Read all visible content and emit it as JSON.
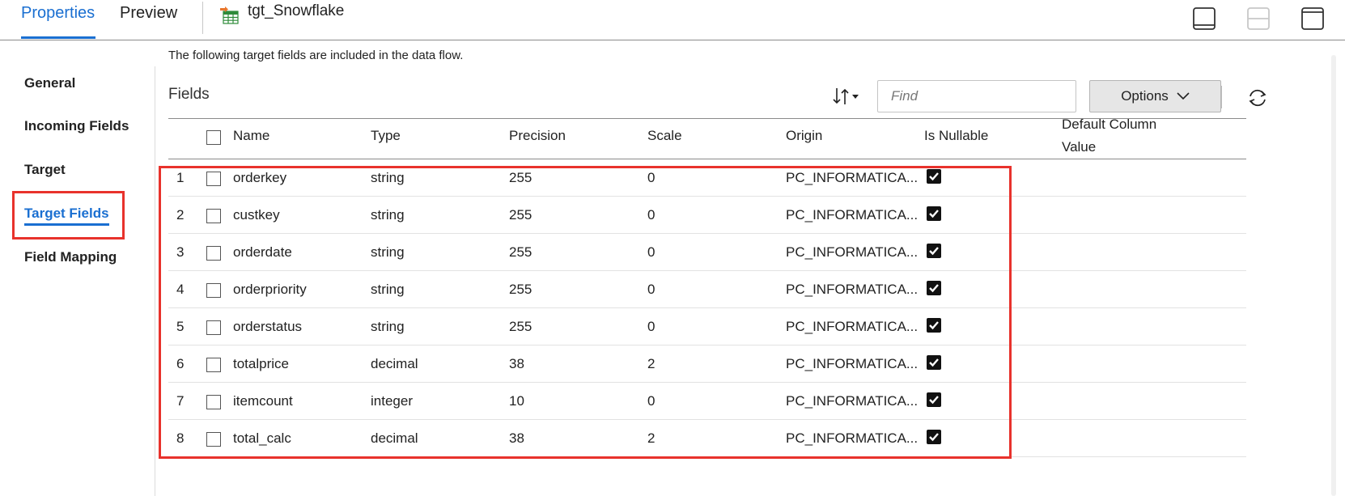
{
  "tabs": {
    "properties": "Properties",
    "preview": "Preview",
    "target_name": "tgt_Snowflake"
  },
  "nav": {
    "items": [
      {
        "label": "General",
        "active": false
      },
      {
        "label": "Incoming Fields",
        "active": false
      },
      {
        "label": "Target",
        "active": false
      },
      {
        "label": "Target Fields",
        "active": true
      },
      {
        "label": "Field Mapping",
        "active": false
      }
    ]
  },
  "main": {
    "description": "The following target fields are included in the data flow.",
    "section_title": "Fields",
    "find_placeholder": "Find",
    "find_value": "",
    "options_label": "Options"
  },
  "table": {
    "headers": {
      "name": "Name",
      "type": "Type",
      "precision": "Precision",
      "scale": "Scale",
      "origin": "Origin",
      "nullable": "Is Nullable",
      "default_value": "Default Column Value"
    },
    "rows": [
      {
        "index": "1",
        "name": "orderkey",
        "type": "string",
        "precision": "255",
        "scale": "0",
        "origin": "PC_INFORMATICA...",
        "nullable": true,
        "default_value": ""
      },
      {
        "index": "2",
        "name": "custkey",
        "type": "string",
        "precision": "255",
        "scale": "0",
        "origin": "PC_INFORMATICA...",
        "nullable": true,
        "default_value": ""
      },
      {
        "index": "3",
        "name": "orderdate",
        "type": "string",
        "precision": "255",
        "scale": "0",
        "origin": "PC_INFORMATICA...",
        "nullable": true,
        "default_value": ""
      },
      {
        "index": "4",
        "name": "orderpriority",
        "type": "string",
        "precision": "255",
        "scale": "0",
        "origin": "PC_INFORMATICA...",
        "nullable": true,
        "default_value": ""
      },
      {
        "index": "5",
        "name": "orderstatus",
        "type": "string",
        "precision": "255",
        "scale": "0",
        "origin": "PC_INFORMATICA...",
        "nullable": true,
        "default_value": ""
      },
      {
        "index": "6",
        "name": "totalprice",
        "type": "decimal",
        "precision": "38",
        "scale": "2",
        "origin": "PC_INFORMATICA...",
        "nullable": true,
        "default_value": ""
      },
      {
        "index": "7",
        "name": "itemcount",
        "type": "integer",
        "precision": "10",
        "scale": "0",
        "origin": "PC_INFORMATICA...",
        "nullable": true,
        "default_value": ""
      },
      {
        "index": "8",
        "name": "total_calc",
        "type": "decimal",
        "precision": "38",
        "scale": "2",
        "origin": "PC_INFORMATICA...",
        "nullable": true,
        "default_value": ""
      }
    ]
  },
  "colors": {
    "accent": "#1a6fd1",
    "highlight": "#e8322c",
    "options_bg": "#e6e6e6"
  },
  "icons": {
    "target": "target-table-icon",
    "layout_bottom": "layout-bottom-panel-icon",
    "layout_split": "layout-split-icon",
    "layout_top": "layout-top-panel-icon",
    "sort": "sort-icon",
    "options_chevron": "chevron-down-icon",
    "refresh": "refresh-icon",
    "nullable_check": "checkmark-icon"
  }
}
